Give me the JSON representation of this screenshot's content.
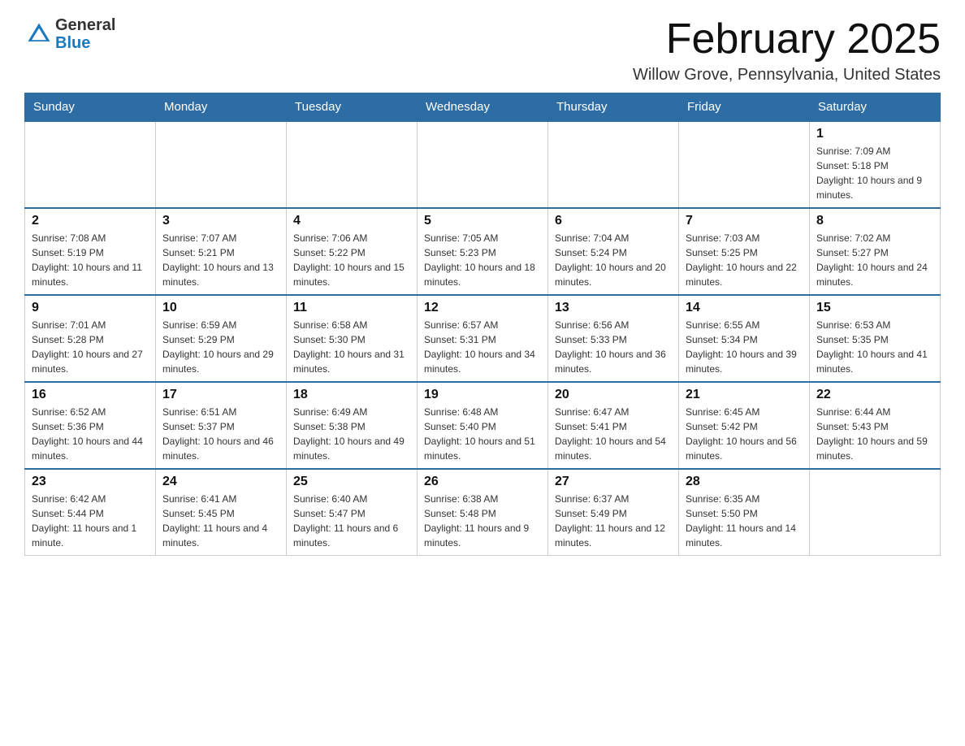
{
  "header": {
    "title": "February 2025",
    "location": "Willow Grove, Pennsylvania, United States",
    "logo_general": "General",
    "logo_blue": "Blue"
  },
  "days_of_week": [
    "Sunday",
    "Monday",
    "Tuesday",
    "Wednesday",
    "Thursday",
    "Friday",
    "Saturday"
  ],
  "weeks": [
    [
      {
        "day": "",
        "info": ""
      },
      {
        "day": "",
        "info": ""
      },
      {
        "day": "",
        "info": ""
      },
      {
        "day": "",
        "info": ""
      },
      {
        "day": "",
        "info": ""
      },
      {
        "day": "",
        "info": ""
      },
      {
        "day": "1",
        "info": "Sunrise: 7:09 AM\nSunset: 5:18 PM\nDaylight: 10 hours and 9 minutes."
      }
    ],
    [
      {
        "day": "2",
        "info": "Sunrise: 7:08 AM\nSunset: 5:19 PM\nDaylight: 10 hours and 11 minutes."
      },
      {
        "day": "3",
        "info": "Sunrise: 7:07 AM\nSunset: 5:21 PM\nDaylight: 10 hours and 13 minutes."
      },
      {
        "day": "4",
        "info": "Sunrise: 7:06 AM\nSunset: 5:22 PM\nDaylight: 10 hours and 15 minutes."
      },
      {
        "day": "5",
        "info": "Sunrise: 7:05 AM\nSunset: 5:23 PM\nDaylight: 10 hours and 18 minutes."
      },
      {
        "day": "6",
        "info": "Sunrise: 7:04 AM\nSunset: 5:24 PM\nDaylight: 10 hours and 20 minutes."
      },
      {
        "day": "7",
        "info": "Sunrise: 7:03 AM\nSunset: 5:25 PM\nDaylight: 10 hours and 22 minutes."
      },
      {
        "day": "8",
        "info": "Sunrise: 7:02 AM\nSunset: 5:27 PM\nDaylight: 10 hours and 24 minutes."
      }
    ],
    [
      {
        "day": "9",
        "info": "Sunrise: 7:01 AM\nSunset: 5:28 PM\nDaylight: 10 hours and 27 minutes."
      },
      {
        "day": "10",
        "info": "Sunrise: 6:59 AM\nSunset: 5:29 PM\nDaylight: 10 hours and 29 minutes."
      },
      {
        "day": "11",
        "info": "Sunrise: 6:58 AM\nSunset: 5:30 PM\nDaylight: 10 hours and 31 minutes."
      },
      {
        "day": "12",
        "info": "Sunrise: 6:57 AM\nSunset: 5:31 PM\nDaylight: 10 hours and 34 minutes."
      },
      {
        "day": "13",
        "info": "Sunrise: 6:56 AM\nSunset: 5:33 PM\nDaylight: 10 hours and 36 minutes."
      },
      {
        "day": "14",
        "info": "Sunrise: 6:55 AM\nSunset: 5:34 PM\nDaylight: 10 hours and 39 minutes."
      },
      {
        "day": "15",
        "info": "Sunrise: 6:53 AM\nSunset: 5:35 PM\nDaylight: 10 hours and 41 minutes."
      }
    ],
    [
      {
        "day": "16",
        "info": "Sunrise: 6:52 AM\nSunset: 5:36 PM\nDaylight: 10 hours and 44 minutes."
      },
      {
        "day": "17",
        "info": "Sunrise: 6:51 AM\nSunset: 5:37 PM\nDaylight: 10 hours and 46 minutes."
      },
      {
        "day": "18",
        "info": "Sunrise: 6:49 AM\nSunset: 5:38 PM\nDaylight: 10 hours and 49 minutes."
      },
      {
        "day": "19",
        "info": "Sunrise: 6:48 AM\nSunset: 5:40 PM\nDaylight: 10 hours and 51 minutes."
      },
      {
        "day": "20",
        "info": "Sunrise: 6:47 AM\nSunset: 5:41 PM\nDaylight: 10 hours and 54 minutes."
      },
      {
        "day": "21",
        "info": "Sunrise: 6:45 AM\nSunset: 5:42 PM\nDaylight: 10 hours and 56 minutes."
      },
      {
        "day": "22",
        "info": "Sunrise: 6:44 AM\nSunset: 5:43 PM\nDaylight: 10 hours and 59 minutes."
      }
    ],
    [
      {
        "day": "23",
        "info": "Sunrise: 6:42 AM\nSunset: 5:44 PM\nDaylight: 11 hours and 1 minute."
      },
      {
        "day": "24",
        "info": "Sunrise: 6:41 AM\nSunset: 5:45 PM\nDaylight: 11 hours and 4 minutes."
      },
      {
        "day": "25",
        "info": "Sunrise: 6:40 AM\nSunset: 5:47 PM\nDaylight: 11 hours and 6 minutes."
      },
      {
        "day": "26",
        "info": "Sunrise: 6:38 AM\nSunset: 5:48 PM\nDaylight: 11 hours and 9 minutes."
      },
      {
        "day": "27",
        "info": "Sunrise: 6:37 AM\nSunset: 5:49 PM\nDaylight: 11 hours and 12 minutes."
      },
      {
        "day": "28",
        "info": "Sunrise: 6:35 AM\nSunset: 5:50 PM\nDaylight: 11 hours and 14 minutes."
      },
      {
        "day": "",
        "info": ""
      }
    ]
  ]
}
